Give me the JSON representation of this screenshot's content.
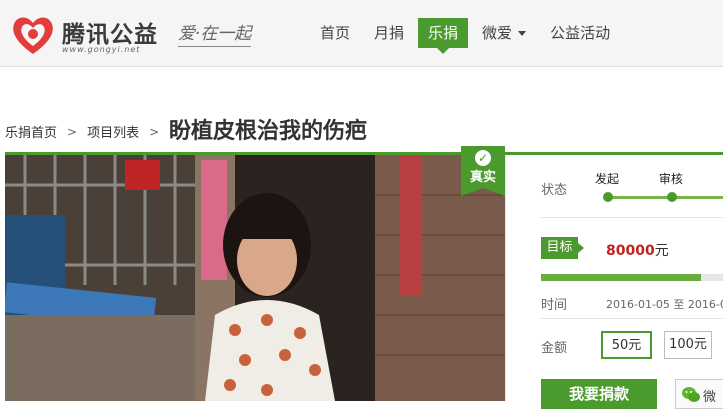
{
  "brand": {
    "name": "腾讯公益",
    "url": "www.gongyi.net",
    "slogan": "爱·在一起",
    "color": "#e23c3c"
  },
  "nav": {
    "items": [
      {
        "label": "首页",
        "active": false
      },
      {
        "label": "月捐",
        "active": false
      },
      {
        "label": "乐捐",
        "active": true
      },
      {
        "label": "微爱",
        "active": false,
        "dropdown": true
      },
      {
        "label": "公益活动",
        "active": false
      }
    ]
  },
  "breadcrumb": {
    "home": "乐捐首页",
    "list": "项目列表"
  },
  "project": {
    "title": "盼植皮根治我的伤疤",
    "badge": "真实"
  },
  "status": {
    "label": "状态",
    "steps": [
      "发起",
      "审核"
    ]
  },
  "goal": {
    "tag": "目标",
    "amount": "80000",
    "unit": "元",
    "progress_fraction": 0.88
  },
  "time": {
    "label": "时间",
    "value": "2016-01-05  至  2016-0"
  },
  "donation": {
    "label": "金额",
    "options": [
      "50元",
      "100元"
    ],
    "selected": "50元",
    "button": "我要捐款",
    "wechat": "微"
  },
  "colors": {
    "accent": "#4a9a2d",
    "amount": "#c0231e"
  }
}
